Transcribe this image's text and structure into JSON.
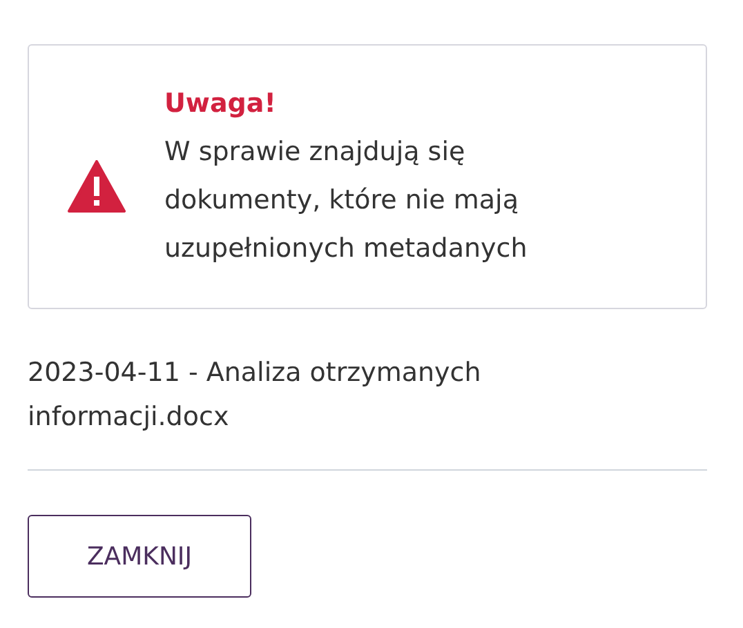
{
  "alert": {
    "title": "Uwaga!",
    "message": "W sprawie znajdują się dokumenty, które nie mają uzupełnionych metadanych"
  },
  "document": "2023-04-11 - Analiza otrzymanych informacji.docx",
  "buttons": [
    "ZAMKNIJ"
  ]
}
